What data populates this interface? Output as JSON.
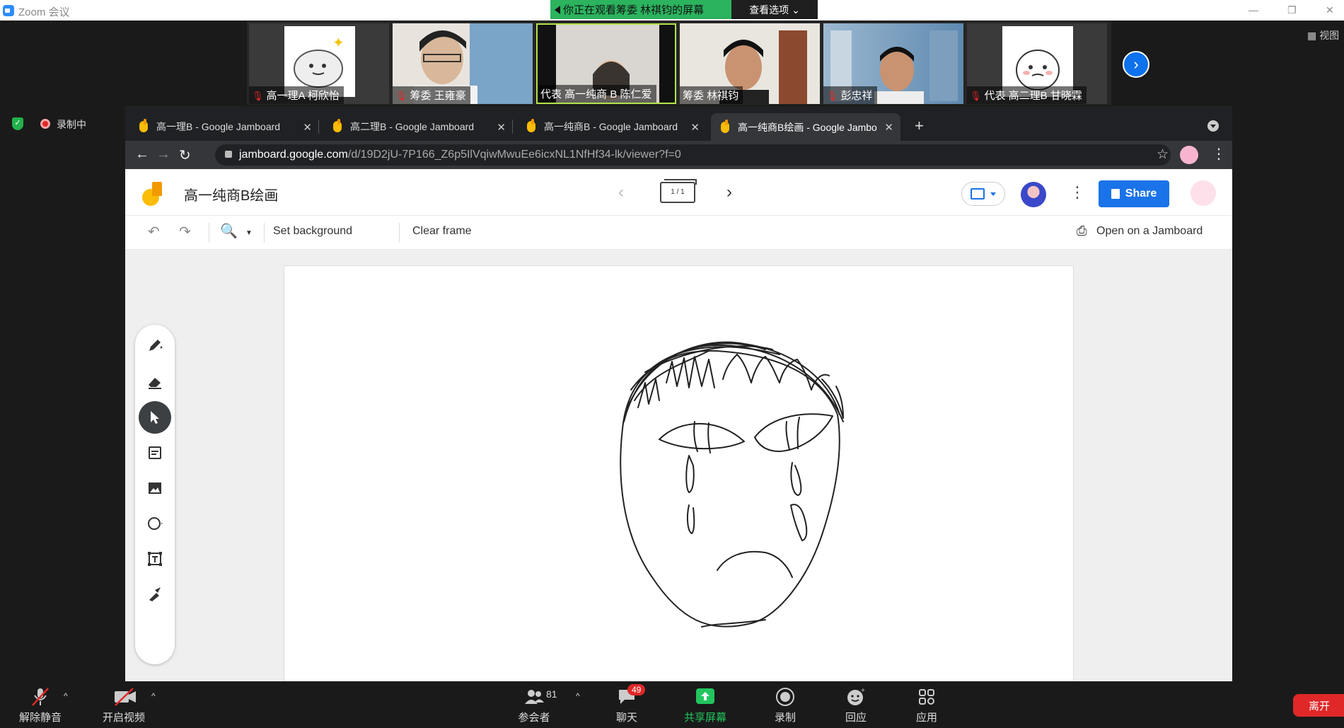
{
  "zoom": {
    "window_title": "Zoom 会议",
    "share_banner": "你正在观看筹委 林祺钧的屏幕",
    "view_options": "查看选项 ⌄",
    "view_toggle": "▦ 视图",
    "recording_label": "录制中",
    "participants": [
      {
        "name": "高一理A 柯欣怡",
        "muted": true
      },
      {
        "name": "筹委 王雍豪",
        "muted": true
      },
      {
        "name": "代表 高一纯商 B 陈仁爱",
        "muted": false
      },
      {
        "name": "筹委 林祺钧",
        "muted": false
      },
      {
        "name": "彭忠祥",
        "muted": true
      },
      {
        "name": "代表 高二理B 甘晓霖",
        "muted": true
      }
    ],
    "bottom": {
      "unmute": "解除静音",
      "start_video": "开启视频",
      "participants_label": "参会者",
      "participants_count": "81",
      "chat": "聊天",
      "chat_badge": "49",
      "share_screen": "共享屏幕",
      "record": "录制",
      "reactions": "回应",
      "apps": "应用",
      "leave": "离开"
    }
  },
  "browser": {
    "tabs": [
      {
        "title": "高一理B - Google Jamboard",
        "active": false
      },
      {
        "title": "高二理B - Google Jamboard",
        "active": false
      },
      {
        "title": "高一纯商B - Google Jamboard",
        "active": false
      },
      {
        "title": "高一纯商B绘画 - Google Jambo",
        "active": true
      }
    ],
    "url_host": "jamboard.google.com",
    "url_path": "/d/19D2jU-7P166_Z6p5IlVqiwMwuEe6icxNL1NfHf34-lk/viewer?f=0"
  },
  "jamboard": {
    "title": "高一纯商B绘画",
    "frame_counter": "1 / 1",
    "share_label": "Share",
    "toolbar": {
      "set_background": "Set background",
      "clear_frame": "Clear frame",
      "open_on_jamboard": "Open on a Jamboard"
    },
    "tools": [
      "pen-icon",
      "eraser-icon",
      "select-icon",
      "sticky-note-icon",
      "image-icon",
      "circle-icon",
      "text-box-icon",
      "laser-icon"
    ],
    "active_tool": "select-icon"
  }
}
